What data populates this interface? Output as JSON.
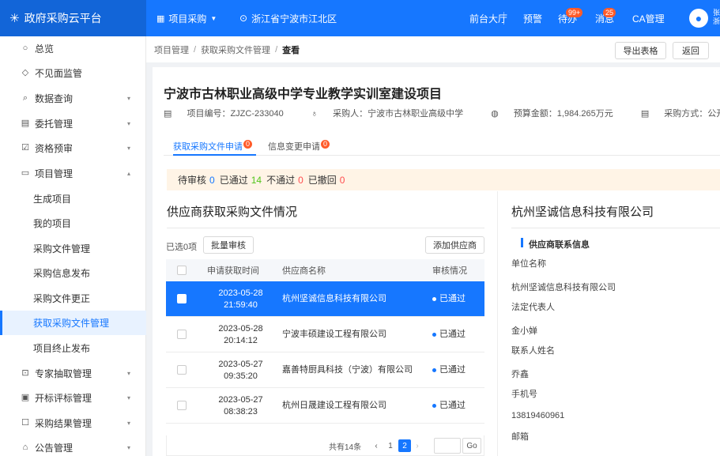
{
  "topbar": {
    "brand": "政府采购云平台",
    "project_menu": "项目采购",
    "location": "浙江省宁波市江北区",
    "front_desk": "前台大厅",
    "alert": "预警",
    "todo": "待办",
    "todo_badge": "99+",
    "message": "消息",
    "message_badge": "25",
    "ca": "CA管理",
    "user": "张\n浙"
  },
  "sidebar": {
    "items": [
      {
        "label": "总览",
        "icon": "circle-icon"
      },
      {
        "label": "不见面监管",
        "icon": "eye-icon"
      },
      {
        "label": "数据查询",
        "icon": "search-icon"
      },
      {
        "label": "委托管理",
        "icon": "doc-icon"
      },
      {
        "label": "资格预审",
        "icon": "check-icon"
      },
      {
        "label": "项目管理",
        "icon": "folder-icon"
      }
    ],
    "sub_items": [
      "生成项目",
      "我的项目",
      "采购文件管理",
      "采购信息发布",
      "采购文件更正",
      "获取采购文件管理",
      "项目终止发布"
    ],
    "bottom_items": [
      {
        "label": "专家抽取管理",
        "icon": "expert-icon"
      },
      {
        "label": "开标评标管理",
        "icon": "bid-icon"
      },
      {
        "label": "采购结果管理",
        "icon": "result-icon"
      },
      {
        "label": "公告管理",
        "icon": "notice-icon"
      }
    ]
  },
  "breadcrumb": {
    "items": [
      "项目管理",
      "获取采购文件管理",
      "查看"
    ],
    "export_label": "导出表格",
    "back_label": "返回"
  },
  "project": {
    "title": "宁波市古林职业高级中学专业教学实训室建设项目",
    "code": "项目编号：ZJZC-233040",
    "buyer": "采购人：宁波市古林职业高级中学",
    "budget": "预算金额：1,984.265万元",
    "method": "采购方式：公开招标"
  },
  "tabs": [
    {
      "label": "获取采购文件申请",
      "badge": "0"
    },
    {
      "label": "信息变更申请",
      "badge": "0"
    }
  ],
  "stats": {
    "pending_label": "待审核",
    "pending": "0",
    "passed_label": "已通过",
    "passed": "14",
    "failed_label": "不通过",
    "failed": "0",
    "withdrawn_label": "已撤回",
    "withdrawn": "0"
  },
  "supplier_section": {
    "title": "供应商获取采购文件情况",
    "selected": "已选0项",
    "batch_label": "批量审核",
    "add_label": "添加供应商",
    "columns": [
      "申请获取时间",
      "供应商名称",
      "审核情况"
    ],
    "rows": [
      {
        "date": "2023-05-28",
        "time": "21:59:40",
        "name": "杭州坚诚信息科技有限公司",
        "status": "已通过"
      },
      {
        "date": "2023-05-28",
        "time": "20:14:12",
        "name": "宁波丰硕建设工程有限公司",
        "status": "已通过"
      },
      {
        "date": "2023-05-27",
        "time": "09:35:20",
        "name": "嘉善特厨具科技（宁波）有限公司",
        "status": "已通过"
      },
      {
        "date": "2023-05-27",
        "time": "08:38:23",
        "name": "杭州日晟建设工程有限公司",
        "status": "已通过"
      }
    ],
    "pager": {
      "total": "共有14条",
      "page1": "1",
      "page2": "2",
      "go": "Go"
    }
  },
  "detail": {
    "title": "杭州坚诚信息科技有限公司",
    "section": "供应商联系信息",
    "fields": [
      {
        "label": "单位名称",
        "value": "杭州坚诚信息科技有限公司"
      },
      {
        "label": "法定代表人",
        "value": "金小婵"
      },
      {
        "label": "联系人姓名",
        "value": "乔鑫"
      },
      {
        "label": "手机号",
        "value": "13819460961"
      },
      {
        "label": "邮箱",
        "value": ""
      }
    ]
  },
  "colors": {
    "accent": "#1677ff",
    "brand_bg": "#1265d8",
    "badge": "#ff5b29",
    "stat_bg": "#fff4e6"
  }
}
